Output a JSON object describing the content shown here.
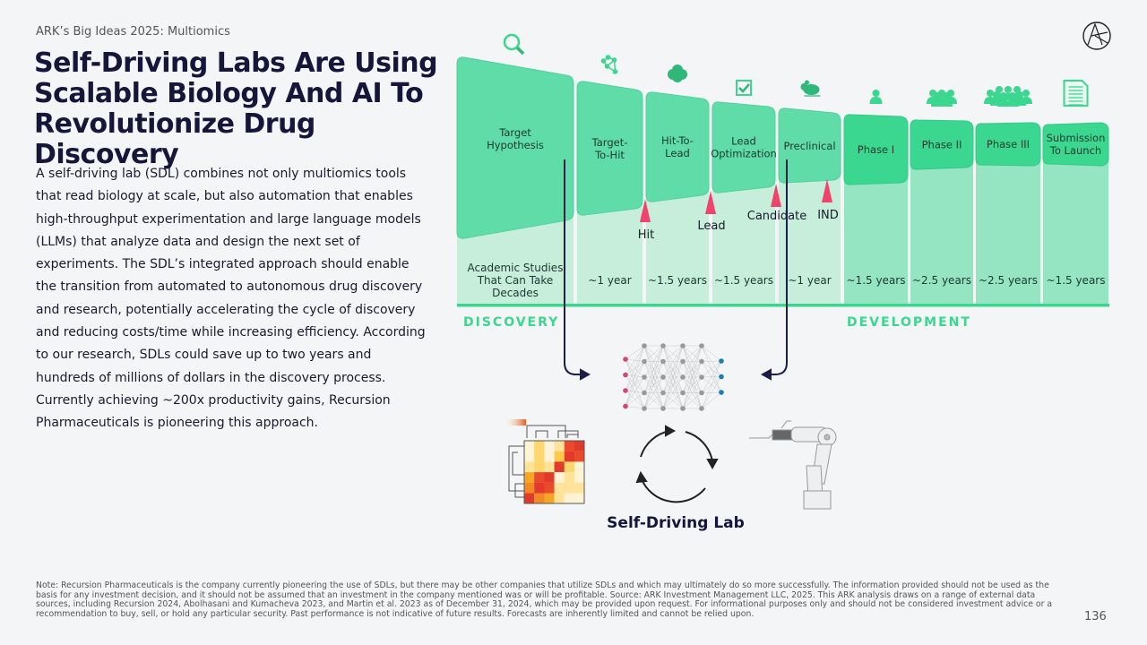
{
  "kicker": "ARK’s Big Ideas 2025: Multiomics",
  "title": "Self-Driving Labs Are Using Scalable Biology And AI To Revolutionize Drug Discovery",
  "body": "A self-driving lab (SDL) combines not only multiomics tools that read biology at scale, but also automation that enables high-throughput experimentation and large language models (LLMs) that analyze data and design the next set of experiments. The SDL’s integrated approach should enable the transition from automated to autonomous drug discovery and research, potentially accelerating the cycle of discovery and reducing costs/time while increasing efficiency. According to our research, SDLs could save up to two years and hundreds of millions of dollars in the discovery process. Currently achieving ~200x productivity gains, Recursion Pharmaceuticals is pioneering this approach.",
  "stages": [
    {
      "label": [
        "Target",
        "Hypothesis"
      ],
      "duration": [
        "Academic Studies",
        "That Can Take",
        "Decades"
      ],
      "icon": "magnifier-icon",
      "section": "discovery"
    },
    {
      "label": [
        "Target-",
        "To-Hit"
      ],
      "duration": [
        "~1 year"
      ],
      "icon": "molecule-network-icon",
      "section": "discovery"
    },
    {
      "label": [
        "Hit-To-",
        "Lead"
      ],
      "duration": [
        "~1.5 years"
      ],
      "icon": "tree-icon",
      "section": "discovery"
    },
    {
      "label": [
        "Lead",
        "Optimization"
      ],
      "duration": [
        "~1.5 years"
      ],
      "icon": "checkbox-icon",
      "section": "discovery"
    },
    {
      "label": [
        "Preclinical"
      ],
      "duration": [
        "~1 year"
      ],
      "icon": "mouse-icon",
      "section": "discovery"
    },
    {
      "label": [
        "Phase I"
      ],
      "duration": [
        "~1.5 years"
      ],
      "icon": "person-icon",
      "section": "development"
    },
    {
      "label": [
        "Phase II"
      ],
      "duration": [
        "~2.5 years"
      ],
      "icon": "small-group-icon",
      "section": "development"
    },
    {
      "label": [
        "Phase III"
      ],
      "duration": [
        "~2.5 years"
      ],
      "icon": "large-group-icon",
      "section": "development"
    },
    {
      "label": [
        "Submission",
        "To Launch"
      ],
      "duration": [
        "~1.5 years"
      ],
      "icon": "document-icon",
      "section": "development"
    }
  ],
  "milestones": [
    "Hit",
    "Lead",
    "Candidate",
    "IND"
  ],
  "sections": {
    "discovery": "DISCOVERY",
    "development": "DEVELOPMENT"
  },
  "cycle_label": "Self-Driving Lab",
  "note": "Note: Recursion Pharmaceuticals is the company currently pioneering the use of SDLs, but there may be other companies that utilize SDLs and which may ultimately do so more successfully. The information provided should not be used as the basis for any investment decision, and it should not be assumed that an investment in the company mentioned was or will be profitable. Source: ARK Investment Management LLC, 2025. This ARK analysis draws on a range of external data sources, including Recursion 2024, Abolhasani and Kumacheva 2023,  and Martin et al. 2023 as of December 31, 2024, which may be provided upon request. For informational purposes only and should not be considered investment advice or a recommendation to buy, sell, or hold any particular security. Past performance is not indicative of future results. Forecasts are inherently limited and cannot be relied upon.",
  "page_number": "136",
  "colors": {
    "discovery_shape": "#5fdca8",
    "discovery_bg": "#c6eedb",
    "development_shape": "#3bd68f",
    "development_bg": "#95e5c3",
    "milestone": "#f0436b",
    "arrow": "#1d1d4a"
  }
}
